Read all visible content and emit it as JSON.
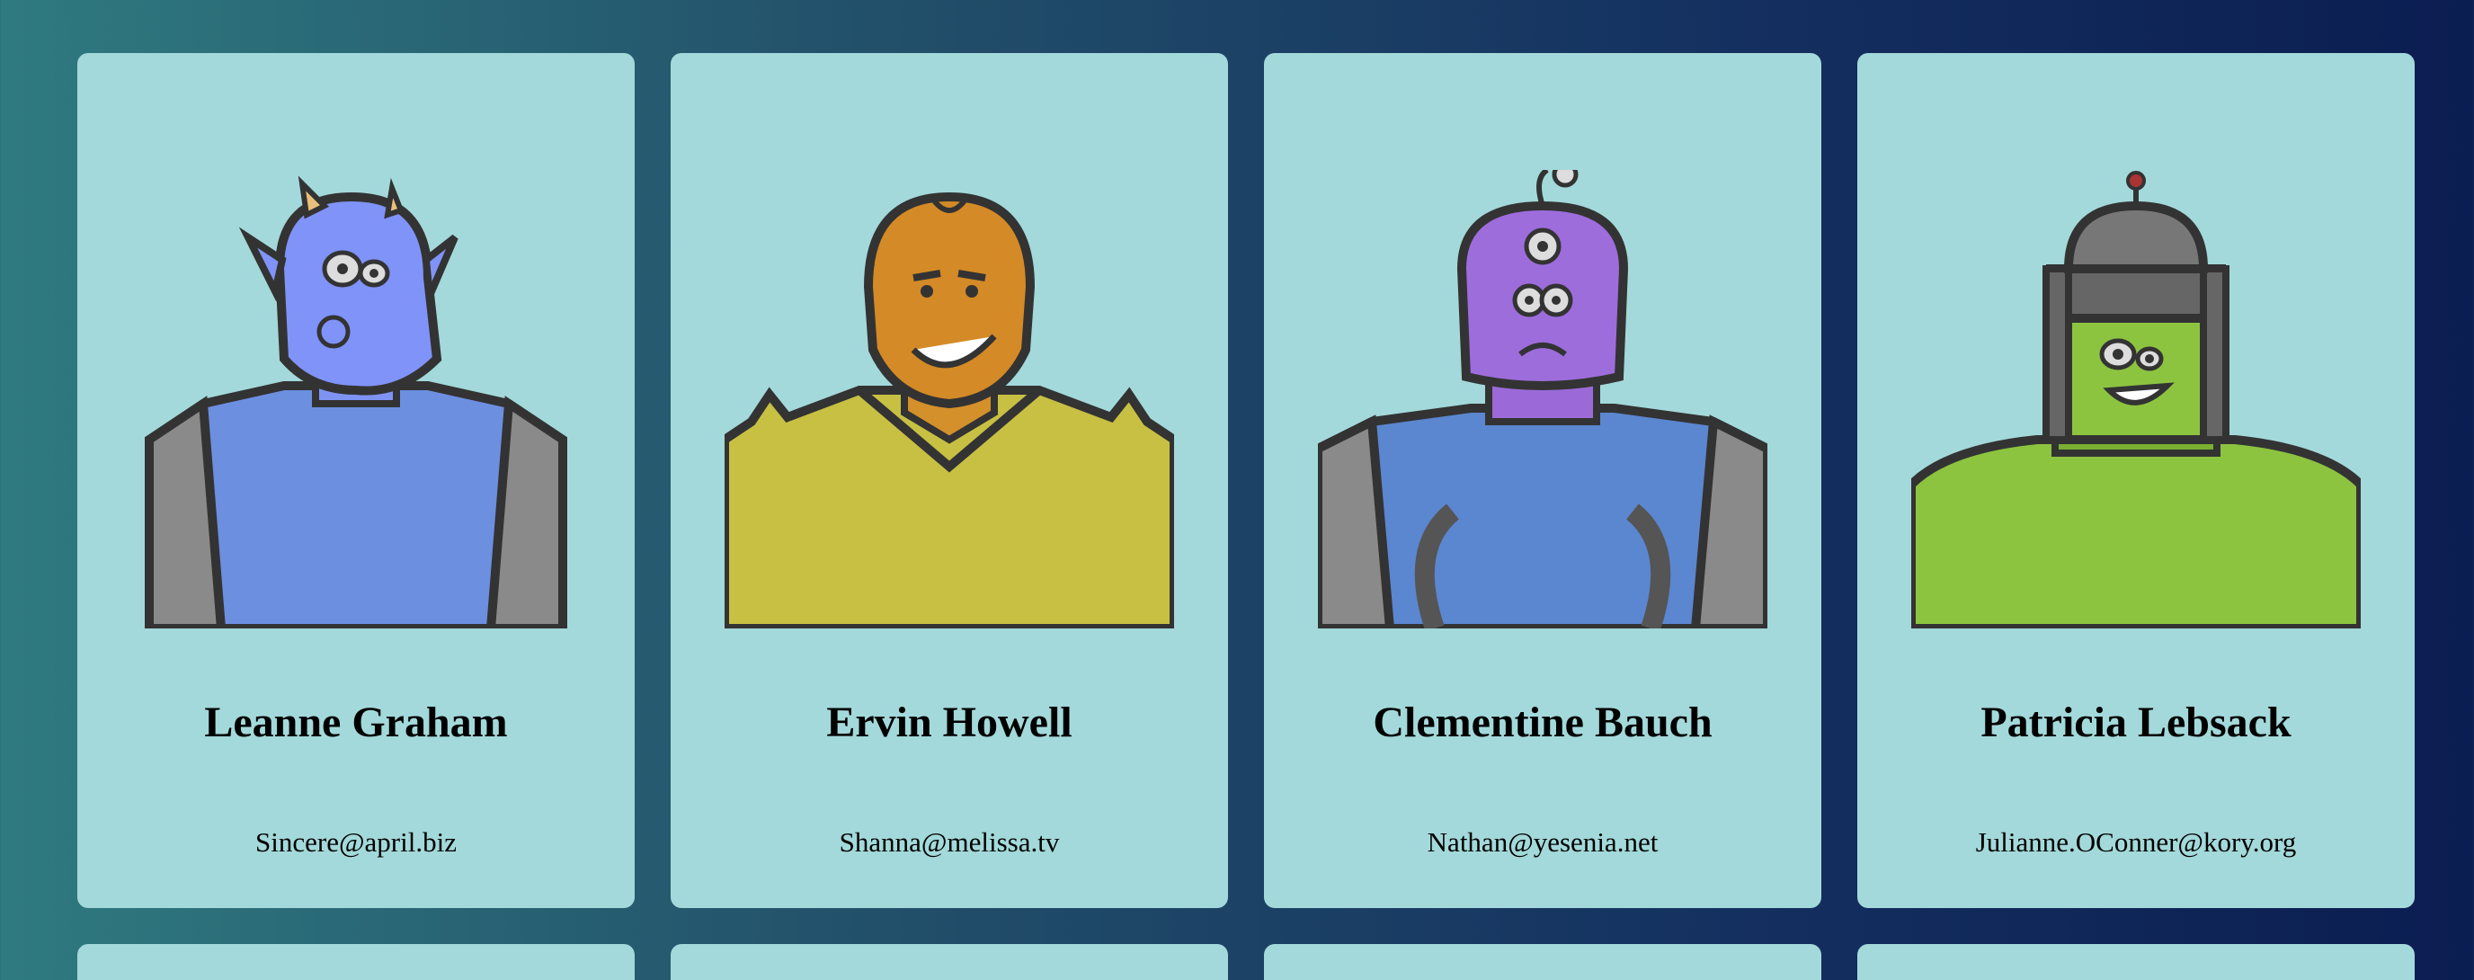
{
  "users": [
    {
      "name": "Leanne Graham",
      "email": "Sincere@april.biz",
      "avatar_icon": "blue-horned-monster-icon"
    },
    {
      "name": "Ervin Howell",
      "email": "Shanna@melissa.tv",
      "avatar_icon": "orange-spiky-monster-icon"
    },
    {
      "name": "Clementine Bauch",
      "email": "Nathan@yesenia.net",
      "avatar_icon": "purple-three-eyed-robot-icon"
    },
    {
      "name": "Patricia Lebsack",
      "email": "Julianne.OConner@kory.org",
      "avatar_icon": "green-helmet-monster-icon"
    }
  ],
  "colors": {
    "card_background": "#a3d9da",
    "background_start": "#2f7a80",
    "background_end": "#0b1d52"
  }
}
